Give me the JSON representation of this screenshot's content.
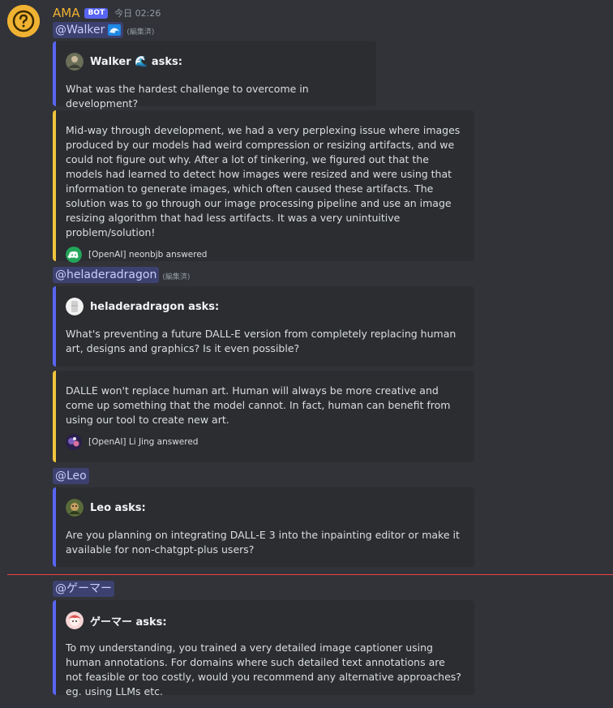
{
  "message": {
    "author": "AMA",
    "badge": "BOT",
    "timestamp": "今日 02:26"
  },
  "threads": [
    {
      "mention": "@Walker",
      "edited": "(編集済)",
      "asker_line": "Walker 🌊 asks:",
      "question": "What was the hardest challenge to overcome in development?",
      "answer": "Mid-way through development, we had a very perplexing issue where images produced by our models had weird compression or resizing artifacts, and we could not figure out why. After a lot of tinkering, we figured out that the models had learned to detect how images were resized and were using that information to generate images, which often caused these artifacts. The solution was to go through our image processing pipeline and use an image resizing algorithm that had less artifacts. It was a very unintuitive problem/solution!",
      "answered_by": "[OpenAI] neonbjb answered"
    },
    {
      "mention": "@heladeradragon",
      "edited": "(編集済)",
      "asker_line": "heladeradragon asks:",
      "question": "What's preventing a future DALL-E version from completely replacing human art, designs and graphics? Is it even possible?",
      "answer": "DALLE won't replace human art. Human will always be more creative and come up something that the model cannot. In fact, human can benefit from using our tool to create new art.",
      "answered_by": "[OpenAI] Li Jing answered"
    },
    {
      "mention": "@Leo",
      "asker_line": "Leo asks:",
      "question": "Are you planning on integrating DALL-E 3 into the inpainting editor or make it available for non-chatgpt-plus users?"
    },
    {
      "mention": "@ゲーマー",
      "asker_line": "ゲーマー asks:",
      "question": "To my understanding, you trained a very detailed image captioner using human annotations. For domains where such detailed text annotations are not feasible or too costly, would you recommend any alternative approaches? eg. using LLMs etc."
    }
  ],
  "colors": {
    "background": "#313338",
    "embed_bg": "#2b2d31",
    "accent_blue": "#5865f2",
    "accent_yellow": "#f0c43c",
    "username": "#f0b232",
    "new_messages_line": "#f23f43"
  }
}
